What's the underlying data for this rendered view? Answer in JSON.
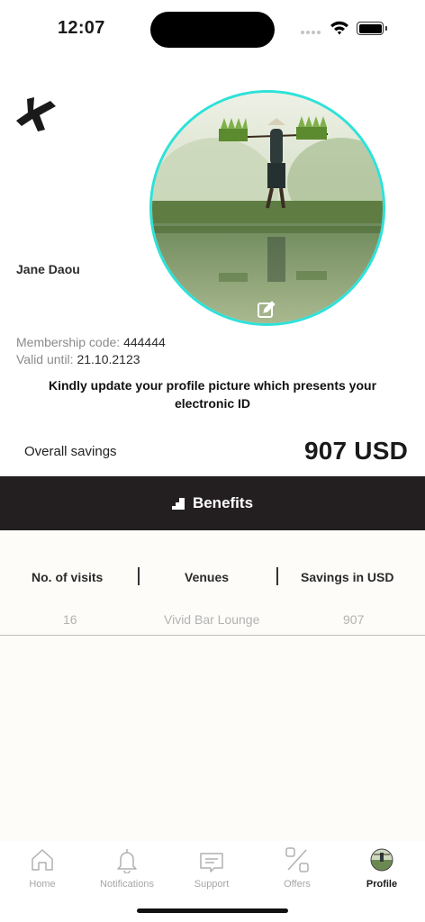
{
  "status_bar": {
    "time": "12:07"
  },
  "profile": {
    "name": "Jane Daou",
    "membership_label": "Membership code:",
    "membership_code": "444444",
    "valid_label": "Valid until:",
    "valid_until": "21.10.2123",
    "notice": "Kindly update your profile picture which presents your electronic ID"
  },
  "savings": {
    "label": "Overall savings",
    "value": "907 USD"
  },
  "benefits": {
    "label": "Benefits",
    "icon": "stairs-icon"
  },
  "table": {
    "headers": [
      "No. of visits",
      "Venues",
      "Savings in USD"
    ],
    "rows": [
      [
        "16",
        "Vivid Bar Lounge",
        "907"
      ]
    ]
  },
  "tabs": [
    {
      "label": "Home",
      "icon": "home-icon"
    },
    {
      "label": "Notifications",
      "icon": "bell-icon"
    },
    {
      "label": "Support",
      "icon": "chat-icon"
    },
    {
      "label": "Offers",
      "icon": "percent-icon"
    },
    {
      "label": "Profile",
      "icon": "avatar-icon",
      "active": true
    }
  ],
  "colors": {
    "accent_ring": "#2de2d8",
    "dark_bar": "#231f20"
  }
}
